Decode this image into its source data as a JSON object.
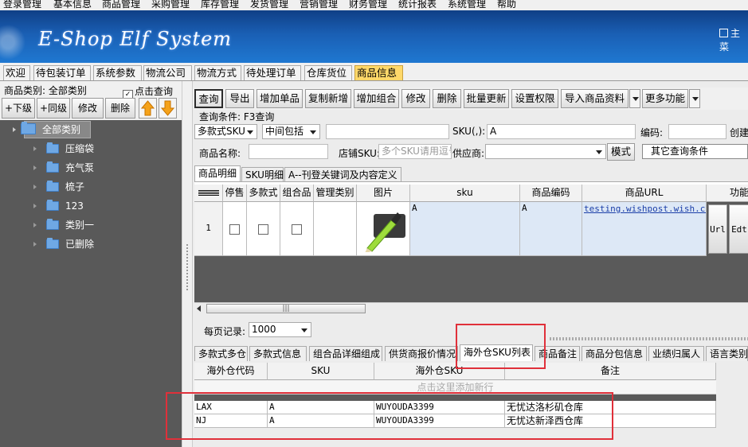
{
  "menu": [
    "登录管理",
    "基本信息",
    "商品管理",
    "采购管理",
    "库存管理",
    "发货管理",
    "营销管理",
    "财务管理",
    "统计报表",
    "系统管理",
    "帮助"
  ],
  "banner": {
    "logo": "E-Shop Elf System",
    "home": "主菜"
  },
  "tabs": [
    "欢迎",
    "待包装订单",
    "系统参数",
    "物流公司",
    "物流方式",
    "待处理订单",
    "仓库货位",
    "商品信息"
  ],
  "active_tab": 7,
  "left": {
    "category_label": "商品类别: 全部类别",
    "click_query": "点击查询",
    "click_query_checked": true,
    "buttons": [
      "+下级",
      "+同级",
      "修改",
      "删除"
    ],
    "tree_root": "全部类别",
    "tree_items": [
      "压缩袋",
      "充气泵",
      "梳子",
      "123",
      "类别一",
      "已删除"
    ]
  },
  "toolbar": {
    "buttons": [
      "查询",
      "导出",
      "增加单品",
      "复制新增",
      "增加组合",
      "修改",
      "删除",
      "批量更新",
      "设置权限",
      "导入商品资料",
      "更多功能"
    ]
  },
  "query": {
    "condition": "查询条件: F3查询",
    "select_multi": "多款式SKU",
    "select_match": "中间包括",
    "sku_label": "SKU(,):",
    "sku_value": "A",
    "code_label": "编码:",
    "create_label": "创建",
    "name_label": "商品名称:",
    "store_sku_label": "店铺SKU:",
    "store_sku_placeholder": "多个SKU请用逗号",
    "supplier_label": "供应商:",
    "mode_button": "模式",
    "other_query": "其它查询条件"
  },
  "detail_tabs": [
    "商品明细",
    "SKU明细",
    "A--刊登关键词及内容定义"
  ],
  "product_grid": {
    "headers": [
      "停售",
      "多款式",
      "组合品",
      "管理类别",
      "图片",
      "sku",
      "商品编码",
      "商品URL",
      "功能"
    ],
    "row": {
      "index": "1",
      "sku": "A",
      "code": "A",
      "url": "testing.wishpost.wish.com",
      "btn_url": "Url",
      "btn_edit": "Edt"
    }
  },
  "per_page": {
    "label": "每页记录:",
    "value": "1000"
  },
  "bottom_tabs": [
    "多款式多仓",
    "多款式信息",
    "组合品详细组成",
    "供货商报价情况",
    "海外仓SKU列表",
    "商品备注",
    "商品分包信息",
    "业绩归属人",
    "语言类别"
  ],
  "bottom_active": 4,
  "sku_grid": {
    "headers": [
      "海外仓代码",
      "SKU",
      "海外仓SKU",
      "备注"
    ],
    "add_row": "点击这里添加新行",
    "rows": [
      {
        "code": "LAX",
        "sku": "A",
        "wsku": "WUYOUDA3399",
        "note": "无忧达洛杉矶仓库"
      },
      {
        "code": "NJ",
        "sku": "A",
        "wsku": "WUYOUDA3399",
        "note": "无忧达新泽西仓库"
      }
    ]
  }
}
